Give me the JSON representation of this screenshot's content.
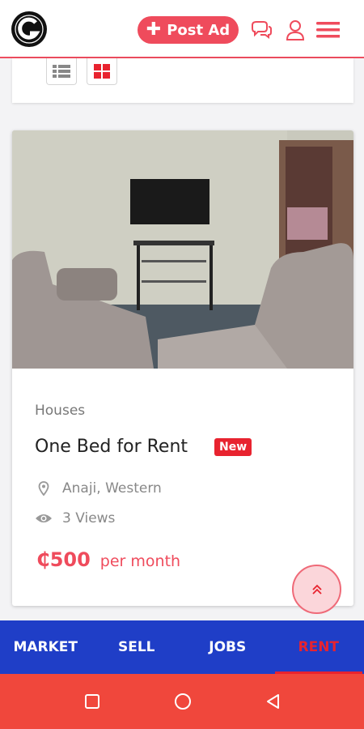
{
  "header": {
    "post_ad_label": "Post Ad",
    "icons": [
      "logo-icon",
      "chat-icon",
      "user-icon",
      "menu-icon"
    ]
  },
  "filters": {
    "view_modes": [
      "list-view-icon",
      "grid-view-icon"
    ]
  },
  "listing": {
    "category": "Houses",
    "title": "One Bed for Rent",
    "badge": "New",
    "location": "Anaji, Western",
    "views": "3 Views",
    "price": "₵500",
    "period": "per month"
  },
  "tabs": [
    {
      "label": "MARKET",
      "active": false
    },
    {
      "label": "SELL",
      "active": false
    },
    {
      "label": "JOBS",
      "active": false
    },
    {
      "label": "RENT",
      "active": true
    }
  ],
  "colors": {
    "accent": "#ef4b5c",
    "tab_bar": "#1f3ec7",
    "badge": "#e8232f",
    "system_nav": "#f0473c"
  }
}
